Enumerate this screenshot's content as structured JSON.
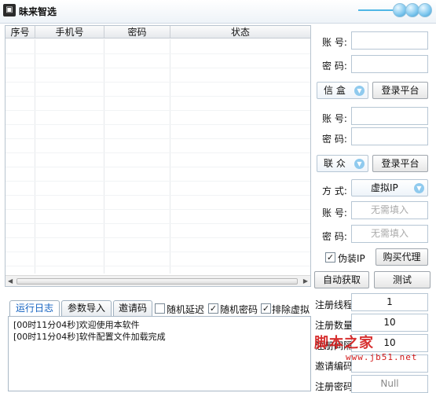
{
  "window": {
    "title": "昧来智选",
    "app_icon": "app-logo-icon"
  },
  "grid": {
    "columns": [
      "序号",
      "手机号",
      "密码",
      "状态"
    ],
    "rows": []
  },
  "login": {
    "account_label": "账 号:",
    "password_label": "密 码:",
    "account_value": "",
    "password_value": ""
  },
  "mail": {
    "select_value": "信 盒",
    "login_button": "登录平台",
    "account_label": "账 号:",
    "password_label": "密 码:"
  },
  "lianzhong": {
    "select_value": "联 众",
    "login_button": "登录平台"
  },
  "proxy": {
    "mode_label": "方 式:",
    "mode_value": "虚拟IP",
    "account_label": "账 号:",
    "account_placeholder": "无需填入",
    "password_label": "密 码:",
    "password_placeholder": "无需填入",
    "fake_ip_label": "伪装IP",
    "fake_ip_checked": true,
    "buy_button": "购买代理",
    "auto_fetch_button": "自动获取",
    "test_button": "测试"
  },
  "tabs": [
    {
      "label": "运行日志",
      "active": true
    },
    {
      "label": "参数导入",
      "active": false
    },
    {
      "label": "邀请码",
      "active": false
    }
  ],
  "options": [
    {
      "label": "随机延迟",
      "checked": false
    },
    {
      "label": "随机密码",
      "checked": true
    },
    {
      "label": "排除虚拟",
      "checked": true
    }
  ],
  "log": [
    "[00时11分04秒]欢迎使用本软件",
    "[00时11分04秒]软件配置文件加载完成"
  ],
  "register": {
    "threads_label": "注册线程",
    "threads_value": "1",
    "count_label": "注册数量",
    "count_value": "10",
    "interval_label": "注册间隔",
    "interval_value": "10",
    "invite_label": "邀请编码",
    "invite_value": "",
    "password_label": "注册密码",
    "password_value": "Null"
  },
  "watermark": {
    "text": "脚本之家",
    "url": "www.jb51.net"
  },
  "colors": {
    "accent": "#4fb7e6",
    "active_tab": "#1060c0",
    "watermark": "#d31a1a"
  }
}
